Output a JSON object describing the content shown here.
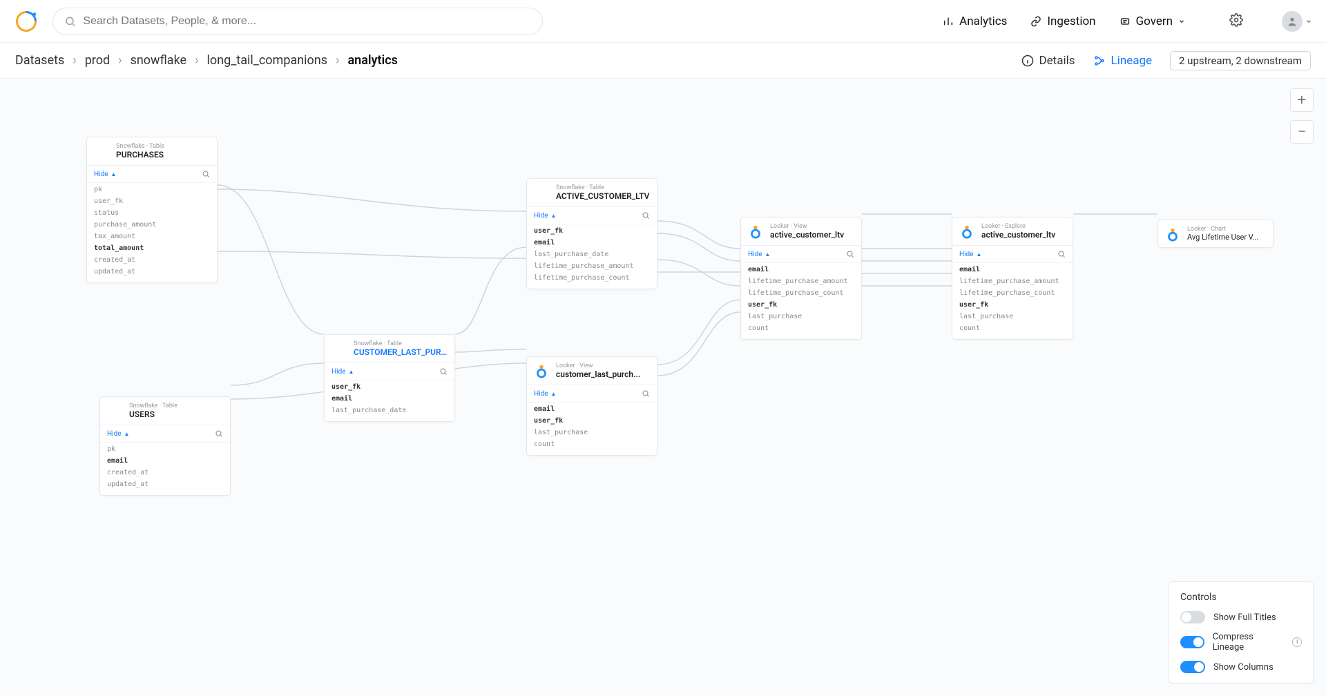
{
  "header": {
    "search_placeholder": "Search Datasets, People, & more...",
    "nav": {
      "analytics": "Analytics",
      "ingestion": "Ingestion",
      "govern": "Govern"
    }
  },
  "breadcrumb": {
    "root": "Datasets",
    "prod": "prod",
    "snowflake": "snowflake",
    "db": "long_tail_companions",
    "current": "analytics"
  },
  "tabs": {
    "details": "Details",
    "lineage": "Lineage"
  },
  "stream_badge": "2 upstream, 2 downstream",
  "hide_label": "Hide",
  "controls_panel": {
    "title": "Controls",
    "show_full_titles": "Show Full Titles",
    "compress_lineage": "Compress Lineage",
    "show_columns": "Show Columns"
  },
  "nodes": {
    "purchases": {
      "sub": "Snowflake · Table",
      "title": "PURCHASES",
      "fields": [
        "pk",
        "user_fk",
        "status",
        "purchase_amount",
        "tax_amount",
        "total_amount",
        "created_at",
        "updated_at"
      ]
    },
    "users": {
      "sub": "Snowflake · Table",
      "title": "USERS",
      "fields": [
        "pk",
        "email",
        "created_at",
        "updated_at"
      ]
    },
    "customer_last_purch": {
      "sub": "Snowflake · Table",
      "title": "CUSTOMER_LAST_PURCH...",
      "fields": [
        "user_fk",
        "email",
        "last_purchase_date"
      ]
    },
    "active_customer_ltv_sf": {
      "sub": "Snowflake · Table",
      "title": "ACTIVE_CUSTOMER_LTV",
      "fields": [
        "user_fk",
        "email",
        "last_purchase_date",
        "lifetime_purchase_amount",
        "lifetime_purchase_count"
      ]
    },
    "customer_last_purch_looker": {
      "sub": "Looker · View",
      "title": "customer_last_purch...",
      "fields": [
        "email",
        "user_fk",
        "last_purchase",
        "count"
      ]
    },
    "active_customer_ltv_looker1": {
      "sub": "Looker · View",
      "title": "active_customer_ltv",
      "fields": [
        "email",
        "lifetime_purchase_amount",
        "lifetime_purchase_count",
        "user_fk",
        "last_purchase",
        "count"
      ]
    },
    "active_customer_ltv_looker2": {
      "sub": "Looker · Explore",
      "title": "active_customer_ltv",
      "fields": [
        "email",
        "lifetime_purchase_amount",
        "lifetime_purchase_count",
        "user_fk",
        "last_purchase",
        "count"
      ]
    },
    "avg_lifetime": {
      "sub": "Looker · Chart",
      "title": "Avg Lifetime User V..."
    }
  }
}
